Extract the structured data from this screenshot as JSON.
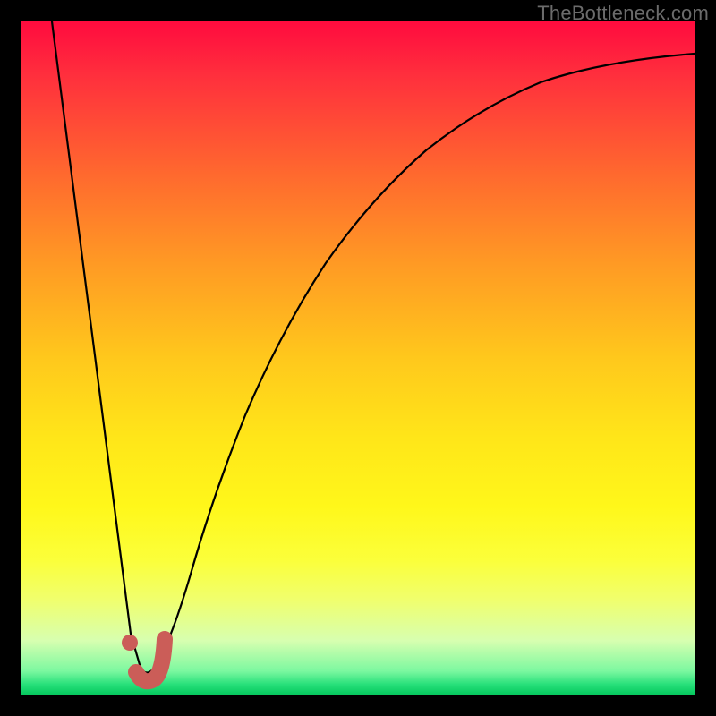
{
  "watermark": {
    "text": "TheBottleneck.com"
  },
  "colors": {
    "curve": "#000000",
    "marker": "#cb5d58",
    "gradient_top": "#ff0b3e",
    "gradient_bottom": "#06c85e"
  },
  "chart_data": {
    "type": "line",
    "title": "",
    "xlabel": "",
    "ylabel": "",
    "xlim": [
      0,
      100
    ],
    "ylim": [
      0,
      100
    ],
    "x": [
      4,
      6,
      8,
      10,
      12,
      14,
      15,
      16,
      17,
      18,
      20,
      22,
      25,
      30,
      35,
      40,
      45,
      50,
      55,
      60,
      65,
      70,
      75,
      80,
      85,
      90,
      95,
      100
    ],
    "values": [
      100,
      84,
      67,
      50,
      33,
      17,
      8,
      2,
      2,
      6,
      15,
      25,
      38,
      53,
      64,
      72,
      78,
      82,
      85,
      87.5,
      89.5,
      91,
      92,
      93,
      93.7,
      94.2,
      94.6,
      95
    ],
    "marker": {
      "x": 15.5,
      "y": 6
    },
    "highlight_segment": {
      "x_start": 16.2,
      "x_end": 19.5
    }
  }
}
